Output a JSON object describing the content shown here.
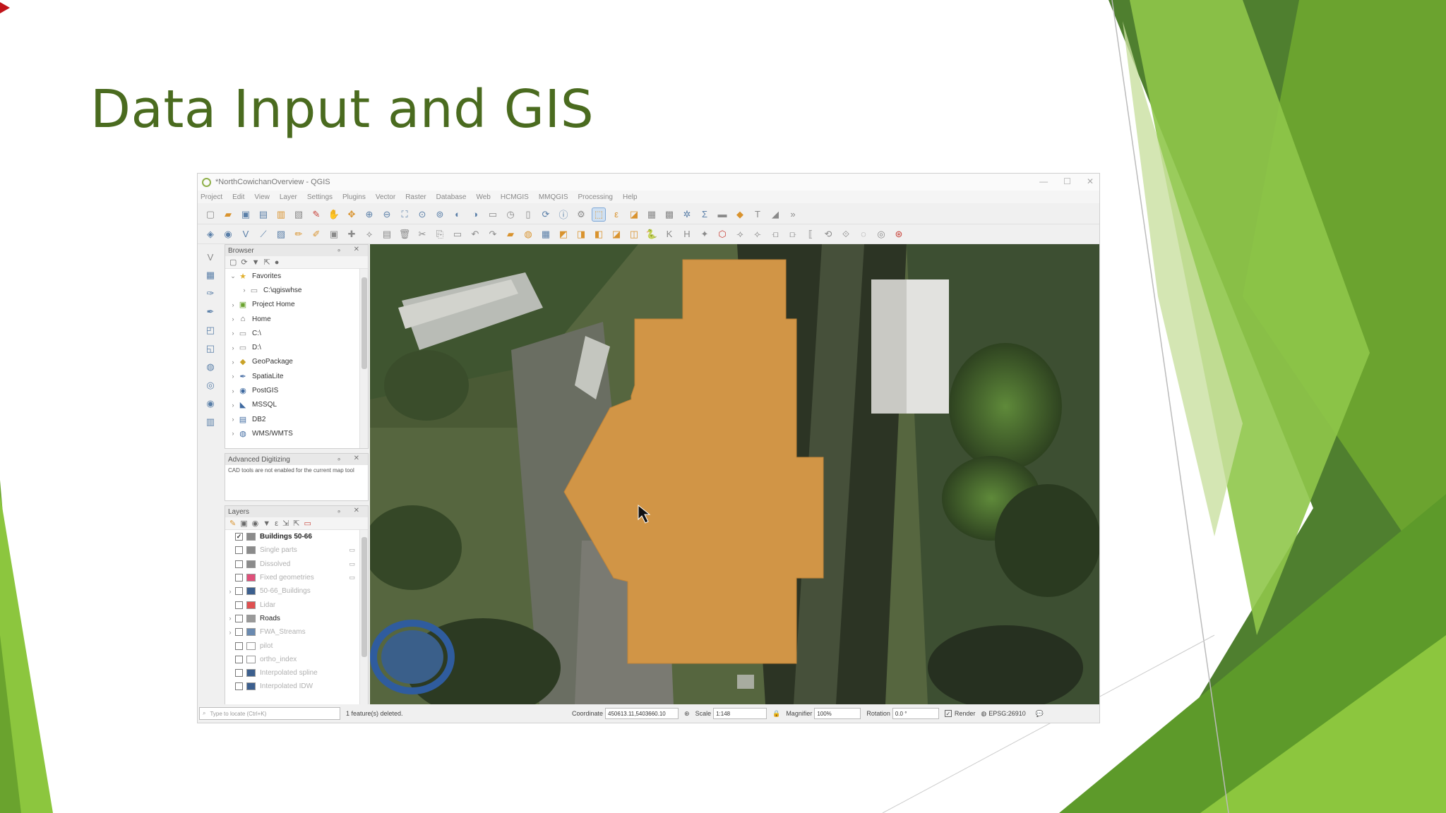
{
  "slide": {
    "title": "Data Input and GIS",
    "colors": {
      "title": "#4a6b1f",
      "accent_dark": "#4e7d2e",
      "accent_mid": "#6aa32e",
      "accent_light": "#8cc63e"
    }
  },
  "window": {
    "title": "*NorthCowichanOverview - QGIS",
    "controls": [
      "—",
      "☐",
      "✕"
    ]
  },
  "menu": [
    "Project",
    "Edit",
    "View",
    "Layer",
    "Settings",
    "Plugins",
    "Vector",
    "Raster",
    "Database",
    "Web",
    "HCMGIS",
    "MMQGIS",
    "Processing",
    "Help"
  ],
  "toolbar_icons": {
    "row1": [
      "new-project-icon",
      "open-project-icon",
      "save-project-icon",
      "save-as-icon",
      "print-layout-icon",
      "layout-manager-icon",
      "style-manager-icon",
      "pan-icon",
      "pan-to-selection-icon",
      "zoom-in-icon",
      "zoom-out-icon",
      "zoom-full-icon",
      "zoom-layer-icon",
      "zoom-selection-icon",
      "zoom-last-icon",
      "zoom-next-icon",
      "new-map-view-icon",
      "temporal-icon",
      "bookmark-icon",
      "refresh-icon",
      "identify-icon",
      "run-action-icon",
      "select-features-icon",
      "select-value-icon",
      "deselect-icon",
      "attribute-table-icon",
      "field-calculator-icon",
      "toolbox-icon",
      "statistics-icon",
      "measure-icon",
      "map-tips-icon",
      "annotation-icon",
      "digitize-icon"
    ],
    "row2": [
      "add-layer-icon",
      "add-raster-icon",
      "add-vector-icon",
      "edit-pencil-icon",
      "save-edits-icon",
      "add-feature-icon",
      "move-feature-icon",
      "vertex-tool-icon",
      "delete-icon",
      "cut-icon",
      "copy-icon",
      "paste-icon",
      "undo-icon",
      "redo-icon",
      "label-icon",
      "pin-label-icon",
      "python-icon",
      "kml-icon",
      "html-icon",
      "plugin-icon"
    ]
  },
  "browser": {
    "title": "Browser",
    "items": [
      {
        "label": "Favorites",
        "icon": "star-icon",
        "expanded": true,
        "indent": 0
      },
      {
        "label": "C:\\qgiswhse",
        "icon": "folder-icon",
        "indent": 1
      },
      {
        "label": "Project Home",
        "icon": "project-home-icon",
        "indent": 0
      },
      {
        "label": "Home",
        "icon": "home-icon",
        "indent": 0
      },
      {
        "label": "C:\\",
        "icon": "folder-icon",
        "indent": 0
      },
      {
        "label": "D:\\",
        "icon": "folder-icon",
        "indent": 0
      },
      {
        "label": "GeoPackage",
        "icon": "geopackage-icon",
        "indent": 0
      },
      {
        "label": "SpatiaLite",
        "icon": "spatialite-icon",
        "indent": 0
      },
      {
        "label": "PostGIS",
        "icon": "postgis-icon",
        "indent": 0
      },
      {
        "label": "MSSQL",
        "icon": "mssql-icon",
        "indent": 0
      },
      {
        "label": "DB2",
        "icon": "db2-icon",
        "indent": 0
      },
      {
        "label": "WMS/WMTS",
        "icon": "wms-icon",
        "indent": 0
      }
    ]
  },
  "advanced_digitizing": {
    "title": "Advanced Digitizing",
    "message": "CAD tools are not enabled for the current map tool"
  },
  "layers": {
    "title": "Layers",
    "items": [
      {
        "label": "Buildings 50-66",
        "checked": true,
        "swatch": "#8b8b8b",
        "style": "on"
      },
      {
        "label": "Single parts",
        "checked": false,
        "swatch": "#8b8b8b",
        "style": "dim",
        "fx": true
      },
      {
        "label": "Dissolved",
        "checked": false,
        "swatch": "#8b8b8b",
        "style": "dim",
        "fx": true
      },
      {
        "label": "Fixed geometries",
        "checked": false,
        "swatch": "#e0507a",
        "style": "dim",
        "fx": true
      },
      {
        "label": "50-66_Buildings",
        "checked": false,
        "swatch": "#3c5f8e",
        "style": "dim",
        "expand": true
      },
      {
        "label": "Lidar",
        "checked": false,
        "swatch": "#e05050",
        "style": "dim"
      },
      {
        "label": "Roads",
        "checked": false,
        "swatch": "#9a9a9a",
        "style": "dark",
        "expand": true
      },
      {
        "label": "FWA_Streams",
        "checked": false,
        "swatch": "#6a8ab0",
        "style": "dim",
        "expand": true
      },
      {
        "label": "pilot",
        "checked": false,
        "swatch": "#ffffff",
        "style": "dim"
      },
      {
        "label": "ortho_index",
        "checked": false,
        "swatch": "#ffffff",
        "style": "dim"
      },
      {
        "label": "Interpolated spline",
        "checked": false,
        "swatch": "#3c5f8e",
        "style": "dim"
      },
      {
        "label": "Interpolated IDW",
        "checked": false,
        "swatch": "#3c5f8e",
        "style": "dim"
      }
    ]
  },
  "map": {
    "polygon_color": "#d19546"
  },
  "status": {
    "locate_placeholder": "Type to locate (Ctrl+K)",
    "message": "1 feature(s) deleted.",
    "coordinate_label": "Coordinate",
    "coordinate_value": "450613.11,5403660.10",
    "scale_label": "Scale",
    "scale_value": "1:148",
    "magnifier_label": "Magnifier",
    "magnifier_value": "100%",
    "rotation_label": "Rotation",
    "rotation_value": "0.0 °",
    "render_label": "Render",
    "crs_label": "EPSG:26910"
  }
}
